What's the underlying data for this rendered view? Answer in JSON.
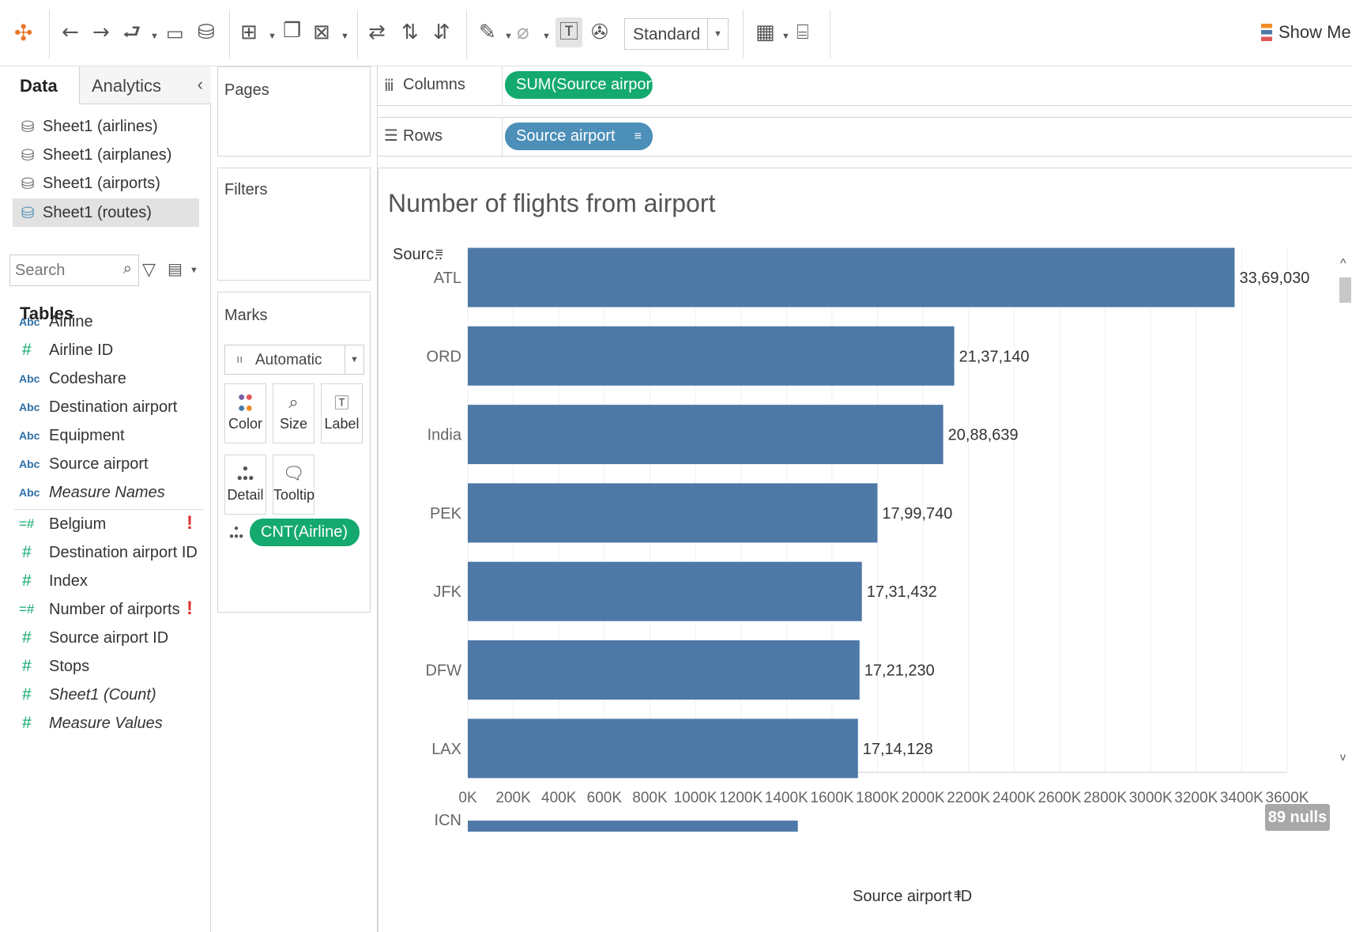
{
  "toolbar": {
    "icons": [
      "tableau-logo-icon",
      "undo-icon",
      "redo-icon",
      "replay-icon",
      "save-icon",
      "new-datasource-icon",
      "new-worksheet-icon",
      "duplicate-icon",
      "clear-sheet-icon",
      "swap-icon",
      "sort-ascending-icon",
      "sort-descending-icon",
      "highlight-icon",
      "group-icon",
      "show-labels-icon",
      "pin-icon",
      "show-cards-icon",
      "presentation-icon"
    ],
    "fit_select": "Standard",
    "show_me": "Show Me"
  },
  "data_pane": {
    "tabs": [
      "Data",
      "Analytics"
    ],
    "active_tab": "Data",
    "datasources": [
      "Sheet1 (airlines)",
      "Sheet1 (airplanes)",
      "Sheet1 (airports)",
      "Sheet1 (routes)"
    ],
    "active_datasource": "Sheet1 (routes)",
    "search_placeholder": "Search",
    "tables_heading": "Tables",
    "dimensions": [
      {
        "type": "Abc",
        "name": "Airline"
      },
      {
        "type": "#",
        "name": "Airline ID"
      },
      {
        "type": "Abc",
        "name": "Codeshare"
      },
      {
        "type": "Abc",
        "name": "Destination airport"
      },
      {
        "type": "Abc",
        "name": "Equipment"
      },
      {
        "type": "Abc",
        "name": "Source airport"
      },
      {
        "type": "Abc",
        "name": "Measure Names"
      }
    ],
    "measures": [
      {
        "type": "=#",
        "name": "Belgium",
        "warning": "!"
      },
      {
        "type": "#",
        "name": "Destination airport ID"
      },
      {
        "type": "#",
        "name": "Index"
      },
      {
        "type": "=#",
        "name": "Number of airports",
        "warning": "!"
      },
      {
        "type": "#",
        "name": "Source airport ID"
      },
      {
        "type": "#",
        "name": "Stops"
      },
      {
        "type": "#",
        "name": "Sheet1 (Count)"
      },
      {
        "type": "#",
        "name": "Measure Values"
      }
    ]
  },
  "cards": {
    "pages": "Pages",
    "filters": "Filters",
    "marks": "Marks",
    "mark_type": "Automatic",
    "mark_buttons": [
      "Color",
      "Size",
      "Label",
      "Detail",
      "Tooltip"
    ],
    "marks_pill": "CNT(Airline)"
  },
  "shelves": {
    "columns_label": "Columns",
    "columns_pill": "SUM(Source airport I..",
    "rows_label": "Rows",
    "rows_pill": "Source airport"
  },
  "view": {
    "title": "Number of flights from airport",
    "row_header": "Sourc..",
    "nulls_badge": "89 nulls",
    "x_axis_title": "Source airport ID"
  },
  "colors": {
    "bar": "#4e79a7",
    "pill_green": "#13a96f",
    "pill_blue": "#4c8fb8"
  },
  "chart_data": {
    "type": "bar",
    "orientation": "horizontal",
    "title": "Number of flights from airport",
    "categories": [
      "ATL",
      "ORD",
      "India",
      "PEK",
      "JFK",
      "DFW",
      "LAX",
      "ICN"
    ],
    "values": [
      3369030,
      2137140,
      2088639,
      1799740,
      1731432,
      1721230,
      1714128,
      1450000
    ],
    "value_labels": [
      "33,69,030",
      "21,37,140",
      "20,88,639",
      "17,99,740",
      "17,31,432",
      "17,21,230",
      "17,14,128",
      ""
    ],
    "xlabel": "Source airport ID",
    "xlim": [
      0,
      3600000
    ],
    "x_ticks": [
      "0K",
      "200K",
      "400K",
      "600K",
      "800K",
      "1000K",
      "1200K",
      "1400K",
      "1600K",
      "1800K",
      "2000K",
      "2200K",
      "2400K",
      "2600K",
      "2800K",
      "3000K",
      "3200K",
      "3400K",
      "3600K"
    ],
    "grid": true
  }
}
